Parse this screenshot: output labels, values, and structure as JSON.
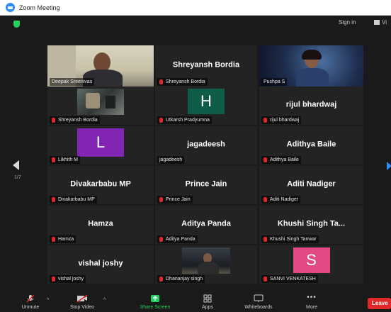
{
  "window": {
    "title": "Zoom Meeting"
  },
  "topbar": {
    "signin_label": "Sign in",
    "view_label": "Vi"
  },
  "gallery": {
    "page_indicator": "1/7"
  },
  "tiles": [
    {
      "display": "",
      "label": "Deepak Sreenivas"
    },
    {
      "display": "Shreyansh Bordia",
      "label": "Shreyansh Bordia"
    },
    {
      "display": "",
      "label": "Pushpa S"
    },
    {
      "display": "",
      "label": "Shreyansh Bordia"
    },
    {
      "display": "H",
      "label": "Utkarsh Pradyumna"
    },
    {
      "display": "rijul bhardwaj",
      "label": "rijul bhardwaj"
    },
    {
      "display": "L",
      "label": "Likhith M"
    },
    {
      "display": "jagadeesh",
      "label": "jagadeesh"
    },
    {
      "display": "Adithya Baile",
      "label": "Adithya Baile"
    },
    {
      "display": "Divakarbabu MP",
      "label": "Divakarbabu MP"
    },
    {
      "display": "Prince Jain",
      "label": "Prince Jain"
    },
    {
      "display": "Aditi Nadiger",
      "label": "Aditi Nadiger"
    },
    {
      "display": "Hamza",
      "label": "Hamza"
    },
    {
      "display": "Aditya Panda",
      "label": "Aditya Panda"
    },
    {
      "display": "Khushi Singh Ta...",
      "label": "Khushi Singh Tanwar"
    },
    {
      "display": "vishal joshy",
      "label": "vishal joshy"
    },
    {
      "display": "",
      "label": "Dhananjay singh"
    },
    {
      "display": "S",
      "label": "SANVI VENKATESH"
    }
  ],
  "colors": {
    "active_speaker_border": "#d9f15b",
    "avatar_h": "#0f5d49",
    "avatar_l": "#8225b3",
    "avatar_s": "#e24a83",
    "muted_mic": "#e02828",
    "share_green": "#23d160",
    "leave_red": "#e02828"
  },
  "toolbar": {
    "unmute": "Unmute",
    "stop_video": "Stop Video",
    "share_screen": "Share Screen",
    "apps": "Apps",
    "whiteboards": "Whiteboards",
    "more": "More",
    "leave": "Leave"
  }
}
